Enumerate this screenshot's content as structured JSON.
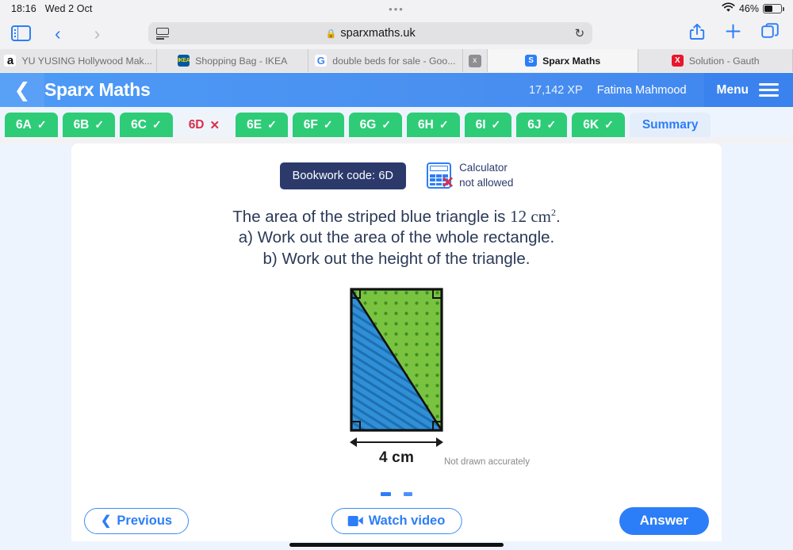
{
  "status_bar": {
    "time": "18:16",
    "date": "Wed 2 Oct",
    "battery_percent": "46%",
    "dots": "•••"
  },
  "browser": {
    "url": "sparxmaths.uk",
    "lock_glyph": "🔒",
    "reload_glyph": "↻",
    "back_glyph": "‹",
    "forward_glyph": "›",
    "share_glyph": "⬆",
    "newtab_glyph": "+",
    "tabs_overview_glyph": "❐",
    "tabs": [
      {
        "title": "YU YUSING Hollywood Mak...",
        "favicon": "amazon-icon",
        "favicon_text": "a",
        "active": false
      },
      {
        "title": "Shopping Bag - IKEA",
        "favicon": "ikea-icon",
        "favicon_text": "IKEA",
        "active": false
      },
      {
        "title": "double beds for sale - Goo...",
        "favicon": "google-icon",
        "favicon_text": "G",
        "active": false
      },
      {
        "title": "",
        "favicon": "close-x-icon",
        "favicon_text": "x",
        "active": false
      },
      {
        "title": "Sparx Maths",
        "favicon": "sparx-icon",
        "favicon_text": "S",
        "active": true
      },
      {
        "title": "Solution - Gauth",
        "favicon": "gauth-icon",
        "favicon_text": "X",
        "active": false
      }
    ]
  },
  "app_header": {
    "back_glyph": "❮",
    "brand": "Sparx Maths",
    "xp": "17,142 XP",
    "user": "Fatima Mahmood",
    "menu_label": "Menu"
  },
  "question_tabs": {
    "items": [
      {
        "label": "6A",
        "state": "done",
        "mark": "✓"
      },
      {
        "label": "6B",
        "state": "done",
        "mark": "✓"
      },
      {
        "label": "6C",
        "state": "done",
        "mark": "✓"
      },
      {
        "label": "6D",
        "state": "current",
        "mark": "✕"
      },
      {
        "label": "6E",
        "state": "done",
        "mark": "✓"
      },
      {
        "label": "6F",
        "state": "done",
        "mark": "✓"
      },
      {
        "label": "6G",
        "state": "done",
        "mark": "✓"
      },
      {
        "label": "6H",
        "state": "done",
        "mark": "✓"
      },
      {
        "label": "6I",
        "state": "done",
        "mark": "✓"
      },
      {
        "label": "6J",
        "state": "done",
        "mark": "✓"
      },
      {
        "label": "6K",
        "state": "done",
        "mark": "✓"
      }
    ],
    "summary_label": "Summary"
  },
  "question": {
    "bookwork_code": "Bookwork code: 6D",
    "calculator_line1": "Calculator",
    "calculator_line2": "not allowed",
    "prompt_line1_a": "The area of the striped blue triangle is ",
    "prompt_line1_value": "12 cm",
    "prompt_line1_exp": "2",
    "prompt_line1_b": ".",
    "prompt_line2": "a) Work out the area of the whole rectangle.",
    "prompt_line3": "b) Work out the height of the triangle.",
    "diagram": {
      "base_label": "4 cm",
      "disclaimer": "Not drawn accurately",
      "blue_fill": "#2f90d8",
      "green_fill": "#79c341",
      "outline": "#111111",
      "blue_region": "striped blue triangle (lower-left)",
      "green_region": "dotted green triangle (upper-right)",
      "right_angle_corners": [
        "top-left",
        "top-right",
        "bottom-left",
        "bottom-right"
      ]
    }
  },
  "footer": {
    "previous_label": "Previous",
    "previous_glyph": "❮",
    "watch_video_label": "Watch video",
    "answer_label": "Answer"
  },
  "colors": {
    "accent_blue": "#2c7ef8",
    "header_blue": "#4a90f0",
    "tab_green": "#2ecc77",
    "error_red": "#d8304a",
    "navy": "#2b3a6b",
    "page_bg": "#eef4fd"
  }
}
